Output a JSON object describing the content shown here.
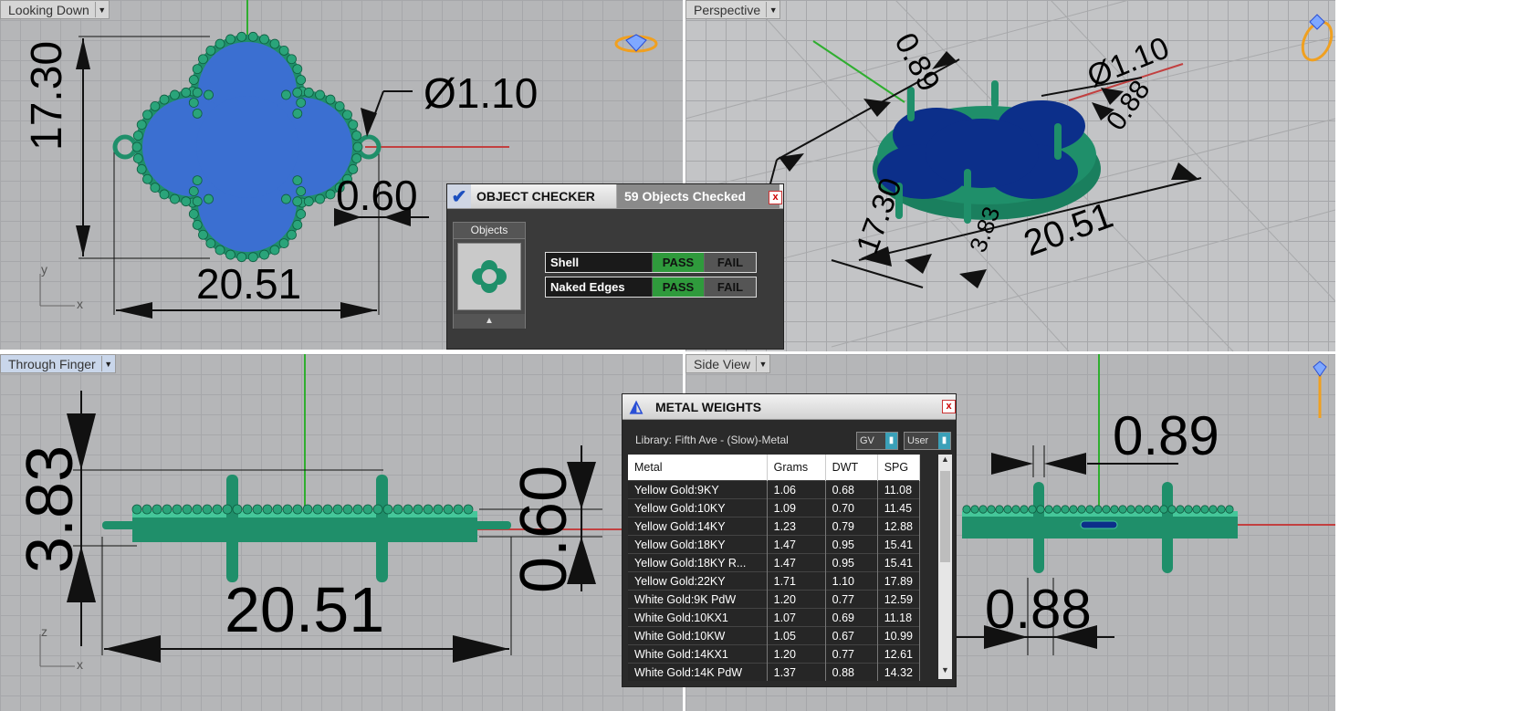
{
  "viewports": {
    "top_left": {
      "label": "Looking Down",
      "dims": {
        "height": "17.30",
        "width": "20.51",
        "diameter": "Ø1.10",
        "gap": "0.60"
      },
      "axes": {
        "y": "y",
        "x": "x"
      }
    },
    "top_right": {
      "label": "Perspective",
      "dims": {
        "a": "0.89",
        "b": "Ø1.10",
        "c": "0.88",
        "d": "20.51",
        "e": "17.30",
        "f": "3.83"
      }
    },
    "bottom_left": {
      "label": "Through Finger",
      "dims": {
        "height": "3.83",
        "width": "20.51",
        "thick": "0.60"
      },
      "axes": {
        "z": "z",
        "x": "x"
      }
    },
    "bottom_right": {
      "label": "Side View",
      "dims": {
        "top": "0.89",
        "bottom": "0.88"
      }
    }
  },
  "object_checker": {
    "title": "OBJECT CHECKER",
    "status": "59  Objects Checked",
    "objects_label": "Objects",
    "rows": [
      {
        "name": "Shell",
        "pass": "PASS",
        "fail": "FAIL"
      },
      {
        "name": "Naked Edges",
        "pass": "PASS",
        "fail": "FAIL"
      }
    ],
    "colors": {
      "pass": "#2f9a3c",
      "fail": "#555555"
    }
  },
  "metal_weights": {
    "title": "METAL WEIGHTS",
    "library": "Library: Fifth Ave - (Slow)-Metal",
    "opt1": "GV",
    "opt2": "User",
    "headers": [
      "Metal",
      "Grams",
      "DWT",
      "SPG"
    ],
    "rows": [
      [
        "Yellow Gold:9KY",
        "1.06",
        "0.68",
        "11.08"
      ],
      [
        "Yellow Gold:10KY",
        "1.09",
        "0.70",
        "11.45"
      ],
      [
        "Yellow Gold:14KY",
        "1.23",
        "0.79",
        "12.88"
      ],
      [
        "Yellow Gold:18KY",
        "1.47",
        "0.95",
        "15.41"
      ],
      [
        "Yellow Gold:18KY R...",
        "1.47",
        "0.95",
        "15.41"
      ],
      [
        "Yellow Gold:22KY",
        "1.71",
        "1.10",
        "17.89"
      ],
      [
        "White Gold:9K PdW",
        "1.20",
        "0.77",
        "12.59"
      ],
      [
        "White Gold:10KX1",
        "1.07",
        "0.69",
        "11.18"
      ],
      [
        "White Gold:10KW",
        "1.05",
        "0.67",
        "10.99"
      ],
      [
        "White Gold:14KX1",
        "1.20",
        "0.77",
        "12.61"
      ],
      [
        "White Gold:14K PdW",
        "1.37",
        "0.88",
        "14.32"
      ]
    ]
  },
  "colors": {
    "metal": "#1f8f6a",
    "stone": "#3b6fd1",
    "stone_dark": "#0c2f8a",
    "viewport_bg": "#b5b6b8"
  }
}
